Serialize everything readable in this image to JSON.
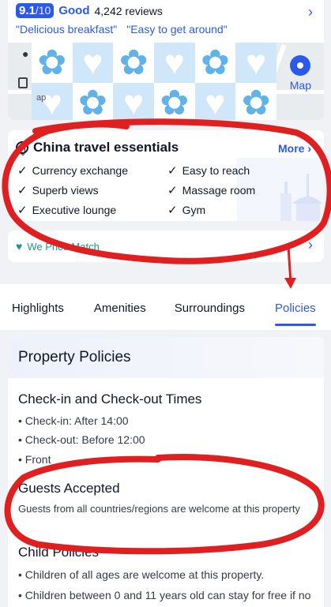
{
  "rating": {
    "score": "9.1",
    "out_of": "/10",
    "word": "Good",
    "reviews": "4,242 reviews",
    "quotes": [
      "\"Delicious breakfast\"",
      "\"Easy to get around\""
    ]
  },
  "map": {
    "label": "Map",
    "partial_text": "ap"
  },
  "essentials": {
    "title": "China travel essentials",
    "more": "More",
    "items": [
      "Currency exchange",
      "Easy to reach",
      "Superb views",
      "Massage room",
      "Executive lounge",
      "Gym"
    ]
  },
  "price_match": {
    "label": "We Price Match"
  },
  "tabs": [
    {
      "label": "Highlights"
    },
    {
      "label": "Amenities"
    },
    {
      "label": "Surroundings"
    },
    {
      "label": "Policies",
      "active": true
    }
  ],
  "policies": {
    "title": "Property Policies",
    "checkin_title": "Check-in and Check-out Times",
    "checkin": "• Check-in: After 14:00",
    "checkout": "• Check-out: Before 12:00",
    "front": "• Front",
    "guests_title": "Guests Accepted",
    "guests_text": "Guests from all countries/regions are welcome at this property",
    "child_title": "Child Policies",
    "child_1": "• Children of all ages are welcome at this property.",
    "child_2": "• Children between 0 and 11 years old can stay for free if no"
  },
  "colors": {
    "accent": "#2b59e8",
    "price_match": "#1a9b8a",
    "annotation": "#e02020"
  }
}
